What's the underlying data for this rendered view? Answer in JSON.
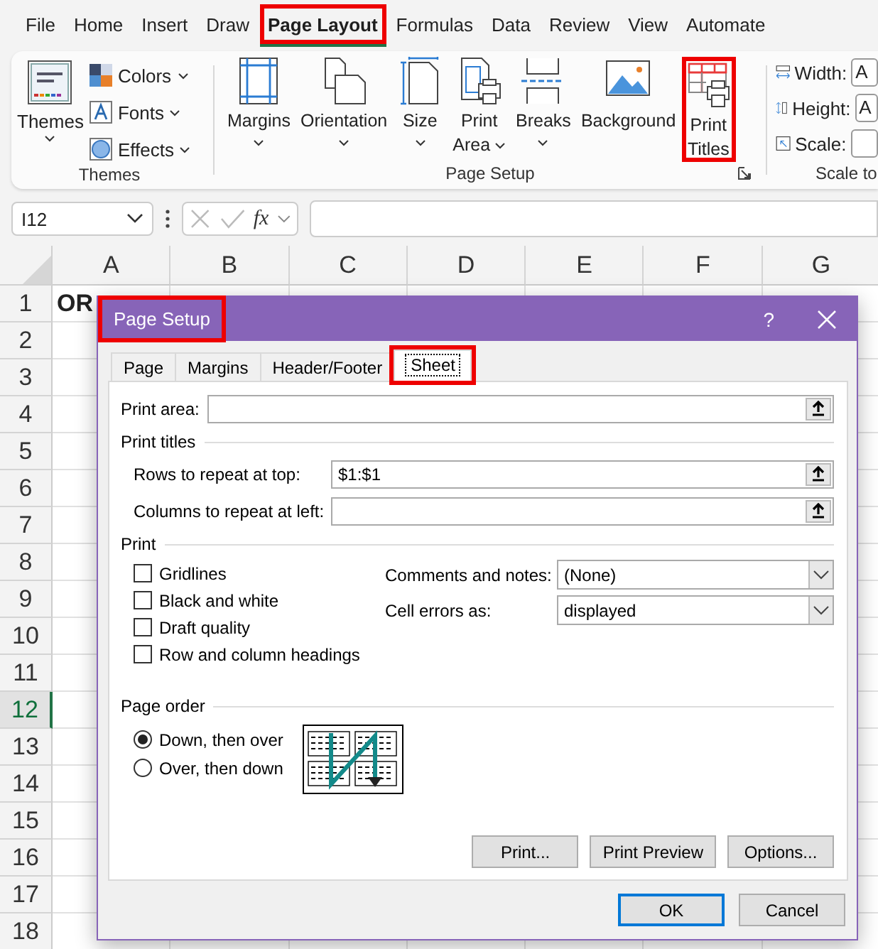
{
  "ribbon_tabs": [
    {
      "label": "File",
      "selected": false,
      "highlighted": false
    },
    {
      "label": "Home",
      "selected": false,
      "highlighted": false
    },
    {
      "label": "Insert",
      "selected": false,
      "highlighted": false
    },
    {
      "label": "Draw",
      "selected": false,
      "highlighted": false
    },
    {
      "label": "Page Layout",
      "selected": true,
      "highlighted": true
    },
    {
      "label": "Formulas",
      "selected": false,
      "highlighted": false
    },
    {
      "label": "Data",
      "selected": false,
      "highlighted": false
    },
    {
      "label": "Review",
      "selected": false,
      "highlighted": false
    },
    {
      "label": "View",
      "selected": false,
      "highlighted": false
    },
    {
      "label": "Automate",
      "selected": false,
      "highlighted": false
    }
  ],
  "themes_group": {
    "label": "Themes",
    "big_button": {
      "label": "Themes"
    },
    "small_buttons": [
      {
        "kind": "colors",
        "label": "Colors"
      },
      {
        "kind": "fonts",
        "label": "Fonts"
      },
      {
        "kind": "effects",
        "label": "Effects"
      }
    ]
  },
  "page_setup_group": {
    "label": "Page Setup",
    "buttons": [
      {
        "kind": "margins",
        "lines": [
          "Margins"
        ],
        "dropdown": true,
        "highlighted": false
      },
      {
        "kind": "orientation",
        "lines": [
          "Orientation"
        ],
        "dropdown": true,
        "highlighted": false
      },
      {
        "kind": "size",
        "lines": [
          "Size"
        ],
        "dropdown": true,
        "highlighted": false
      },
      {
        "kind": "print_area",
        "lines": [
          "Print",
          "Area"
        ],
        "dropdown": true,
        "highlighted": false
      },
      {
        "kind": "breaks",
        "lines": [
          "Breaks"
        ],
        "dropdown": true,
        "highlighted": false
      },
      {
        "kind": "background",
        "lines": [
          "Background"
        ],
        "dropdown": false,
        "highlighted": false
      },
      {
        "kind": "print_titles",
        "lines": [
          "Print",
          "Titles"
        ],
        "dropdown": false,
        "highlighted": true
      }
    ]
  },
  "scale_group": {
    "label": "Scale to",
    "fields": [
      {
        "kind": "width",
        "label": "Width:",
        "value": "A"
      },
      {
        "kind": "height",
        "label": "Height:",
        "value": "A"
      },
      {
        "kind": "scale",
        "label": "Scale:"
      }
    ]
  },
  "formula_bar": {
    "name_box": "I12",
    "function_label": "fx"
  },
  "sheet": {
    "columns": [
      "A",
      "B",
      "C",
      "D",
      "E",
      "F",
      "G"
    ],
    "rows": [
      {
        "label": "1",
        "selected": false
      },
      {
        "label": "2",
        "selected": false
      },
      {
        "label": "3",
        "selected": false
      },
      {
        "label": "4",
        "selected": false
      },
      {
        "label": "5",
        "selected": false
      },
      {
        "label": "6",
        "selected": false
      },
      {
        "label": "7",
        "selected": false
      },
      {
        "label": "8",
        "selected": false
      },
      {
        "label": "9",
        "selected": false
      },
      {
        "label": "10",
        "selected": false
      },
      {
        "label": "11",
        "selected": false
      },
      {
        "label": "12",
        "selected": true
      },
      {
        "label": "13",
        "selected": false
      },
      {
        "label": "14",
        "selected": false
      },
      {
        "label": "15",
        "selected": false
      },
      {
        "label": "16",
        "selected": false
      },
      {
        "label": "17",
        "selected": false
      },
      {
        "label": "18",
        "selected": false
      }
    ],
    "cell_a1": "OR"
  },
  "dialog": {
    "title": "Page Setup",
    "title_highlighted": true,
    "help": "?",
    "tabs": [
      {
        "label": "Page",
        "selected": false,
        "highlighted": false
      },
      {
        "label": "Margins",
        "selected": false,
        "highlighted": false
      },
      {
        "label": "Header/Footer",
        "selected": false,
        "highlighted": false
      },
      {
        "label": "Sheet",
        "selected": true,
        "highlighted": true
      }
    ],
    "print_area": {
      "label": "Print area:"
    },
    "print_titles_heading": "Print titles",
    "rows_to_repeat": {
      "label": "Rows to repeat at top:",
      "value": "$1:$1"
    },
    "columns_to_repeat": {
      "label": "Columns to repeat at left:"
    },
    "print_heading": "Print",
    "print_options": [
      {
        "label": "Gridlines",
        "checked": false
      },
      {
        "label": "Black and white",
        "checked": false
      },
      {
        "label": "Draft quality",
        "checked": false
      },
      {
        "label": "Row and column headings",
        "checked": false
      }
    ],
    "dropdowns": [
      {
        "label": "Comments and notes:",
        "value": "(None)"
      },
      {
        "label": "Cell errors as:",
        "value": "displayed"
      }
    ],
    "page_order_heading": "Page order",
    "page_order": [
      {
        "label": "Down, then over",
        "selected": true
      },
      {
        "label": "Over, then down",
        "selected": false
      }
    ],
    "panel_buttons": [
      "Print...",
      "Print Preview",
      "Options..."
    ],
    "buttons": [
      {
        "label": "OK",
        "default": true
      },
      {
        "label": "Cancel",
        "default": false
      }
    ]
  }
}
